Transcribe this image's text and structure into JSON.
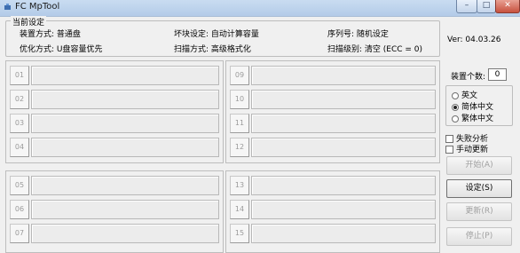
{
  "window": {
    "title": "FC MpTool",
    "min": "–",
    "max": "□",
    "close": "✕"
  },
  "current_settings": {
    "legend": "当前设定",
    "device_mode": "装置方式: 普通盘",
    "block_setting": "坏块设定: 自动计算容量",
    "serial": "序列号: 随机设定",
    "optimize": "优化方式: U盘容量优先",
    "scan_mode": "扫描方式: 高级格式化",
    "scan_level": "扫描级别: 清空 (ECC = 0)"
  },
  "version": "Ver: 04.03.26",
  "device_count": {
    "label": "装置个数:",
    "value": "0"
  },
  "languages": [
    {
      "label": "英文",
      "selected": false
    },
    {
      "label": "简体中文",
      "selected": true
    },
    {
      "label": "繁体中文",
      "selected": false
    }
  ],
  "options": [
    {
      "label": "失败分析",
      "checked": false
    },
    {
      "label": "手动更新",
      "checked": false
    }
  ],
  "buttons": {
    "start": "开始(A)",
    "settings": "设定(S)",
    "update": "更新(R)",
    "stop": "停止(P)"
  },
  "slots": {
    "panel_top_left": [
      "01",
      "02",
      "03",
      "04"
    ],
    "panel_top_right": [
      "09",
      "10",
      "11",
      "12"
    ],
    "panel_bottom_left": [
      "05",
      "06",
      "07"
    ],
    "panel_bottom_right": [
      "13",
      "14",
      "15"
    ]
  }
}
